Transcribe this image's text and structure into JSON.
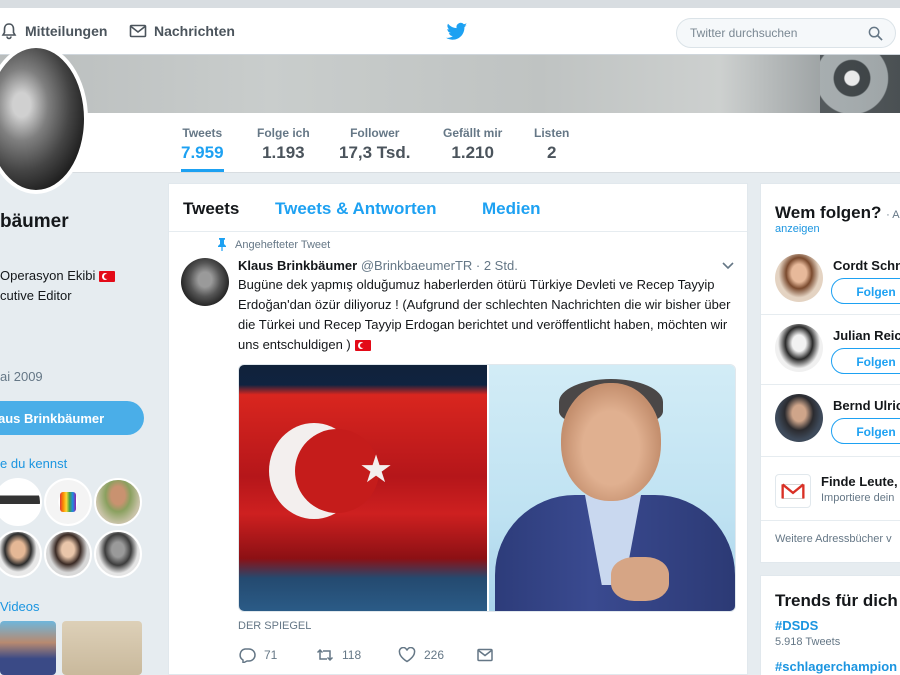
{
  "nav": {
    "notifications": "Mitteilungen",
    "messages": "Nachrichten",
    "search_placeholder": "Twitter durchsuchen"
  },
  "stats": [
    {
      "label": "Tweets",
      "value": "7.959"
    },
    {
      "label": "Folge ich",
      "value": "1.193"
    },
    {
      "label": "Follower",
      "value": "17,3 Tsd."
    },
    {
      "label": "Gefällt mir",
      "value": "1.210"
    },
    {
      "label": "Listen",
      "value": "2"
    }
  ],
  "profile": {
    "name": "bäumer",
    "bio_line1": "Operasyon Ekibi",
    "bio_line2": "cutive Editor",
    "joined": "ai 2009",
    "tweet_button": "aus Brinkbäumer",
    "followers_you_know": "e du kennst",
    "videos": "Videos"
  },
  "timeline": {
    "tabs": [
      "Tweets",
      "Tweets & Antworten",
      "Medien"
    ],
    "pinned_label": "Angehefteter Tweet",
    "tweet": {
      "name": "Klaus Brinkbäumer",
      "handle": "@BrinkbaeumerTR · 2 Std.",
      "text": "Bugüne dek yapmış olduğumuz haberlerden ötürü Türkiye Devleti ve Recep Tayyip Erdoğan'dan özür diliyoruz ! (Aufgrund der schlechten Nachrichten die wir bisher über die Türkei und Recep Tayyip Erdogan berichtet und veröffentlicht haben, möchten wir uns entschuldigen )",
      "source": "DER SPIEGEL",
      "replies": "71",
      "retweets": "118",
      "likes": "226"
    }
  },
  "who_to_follow": {
    "title": "Wem folgen?",
    "title_suffix": "· A",
    "refresh": "anzeigen",
    "suggestions": [
      {
        "name": "Cordt Schn",
        "button": "Folgen"
      },
      {
        "name": "Julian Reic",
        "button": "Folgen"
      },
      {
        "name": "Bernd Ulric",
        "button": "Folgen"
      }
    ],
    "find_people": "Finde Leute,",
    "import": "Importiere dein",
    "more_books": "Weitere Adressbücher v"
  },
  "trends": {
    "title": "Trends für dich",
    "items": [
      {
        "tag": "#DSDS",
        "count": "5.918 Tweets"
      },
      {
        "tag": "#schlagerchampion"
      }
    ]
  },
  "colors": {
    "accent": "#1da1f2",
    "background": "#e6ecf0"
  }
}
